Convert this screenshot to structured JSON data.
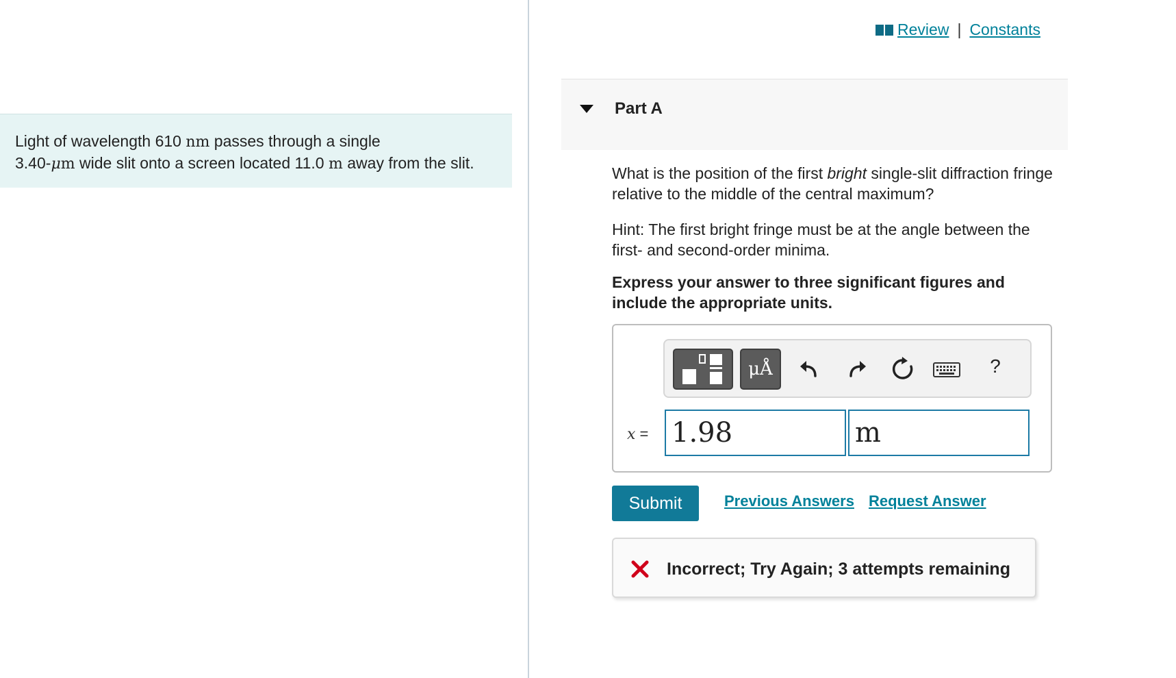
{
  "problem": {
    "text_1": "Light of wavelength 610 ",
    "unit_nm": "nm",
    "text_2": " passes through a single",
    "text_3": "3.40-",
    "unit_mu": "μ",
    "unit_m_1": "m",
    "text_4": " wide slit onto a screen located 11.0 ",
    "unit_m_2": "m",
    "text_5": " away from the slit."
  },
  "top_links": {
    "review": " Review",
    "separator": "|",
    "constants": "Constants"
  },
  "part": {
    "title": "Part A"
  },
  "question": {
    "text_before": "What is the position of the first ",
    "emphasis": "bright",
    "text_after": " single-slit diffraction fringe relative to the middle of the central maximum?"
  },
  "hint": "Hint: The first bright fringe must be at the angle between the first- and second-order minima.",
  "instructions": "Express your answer to three significant figures and include the appropriate units.",
  "toolbar": {
    "units_label": "μÅ",
    "help_label": "?"
  },
  "answer": {
    "variable": "x",
    "equals": " =",
    "value": "1.98",
    "unit": "m"
  },
  "actions": {
    "submit": "Submit",
    "previous_answers": "Previous Answers",
    "request_answer": "Request Answer"
  },
  "feedback": {
    "message": "Incorrect; Try Again; 3 attempts remaining"
  },
  "colors": {
    "accent": "#00819a",
    "submit": "#117a98",
    "error": "#d0021b",
    "problem_bg": "#e6f4f4"
  }
}
